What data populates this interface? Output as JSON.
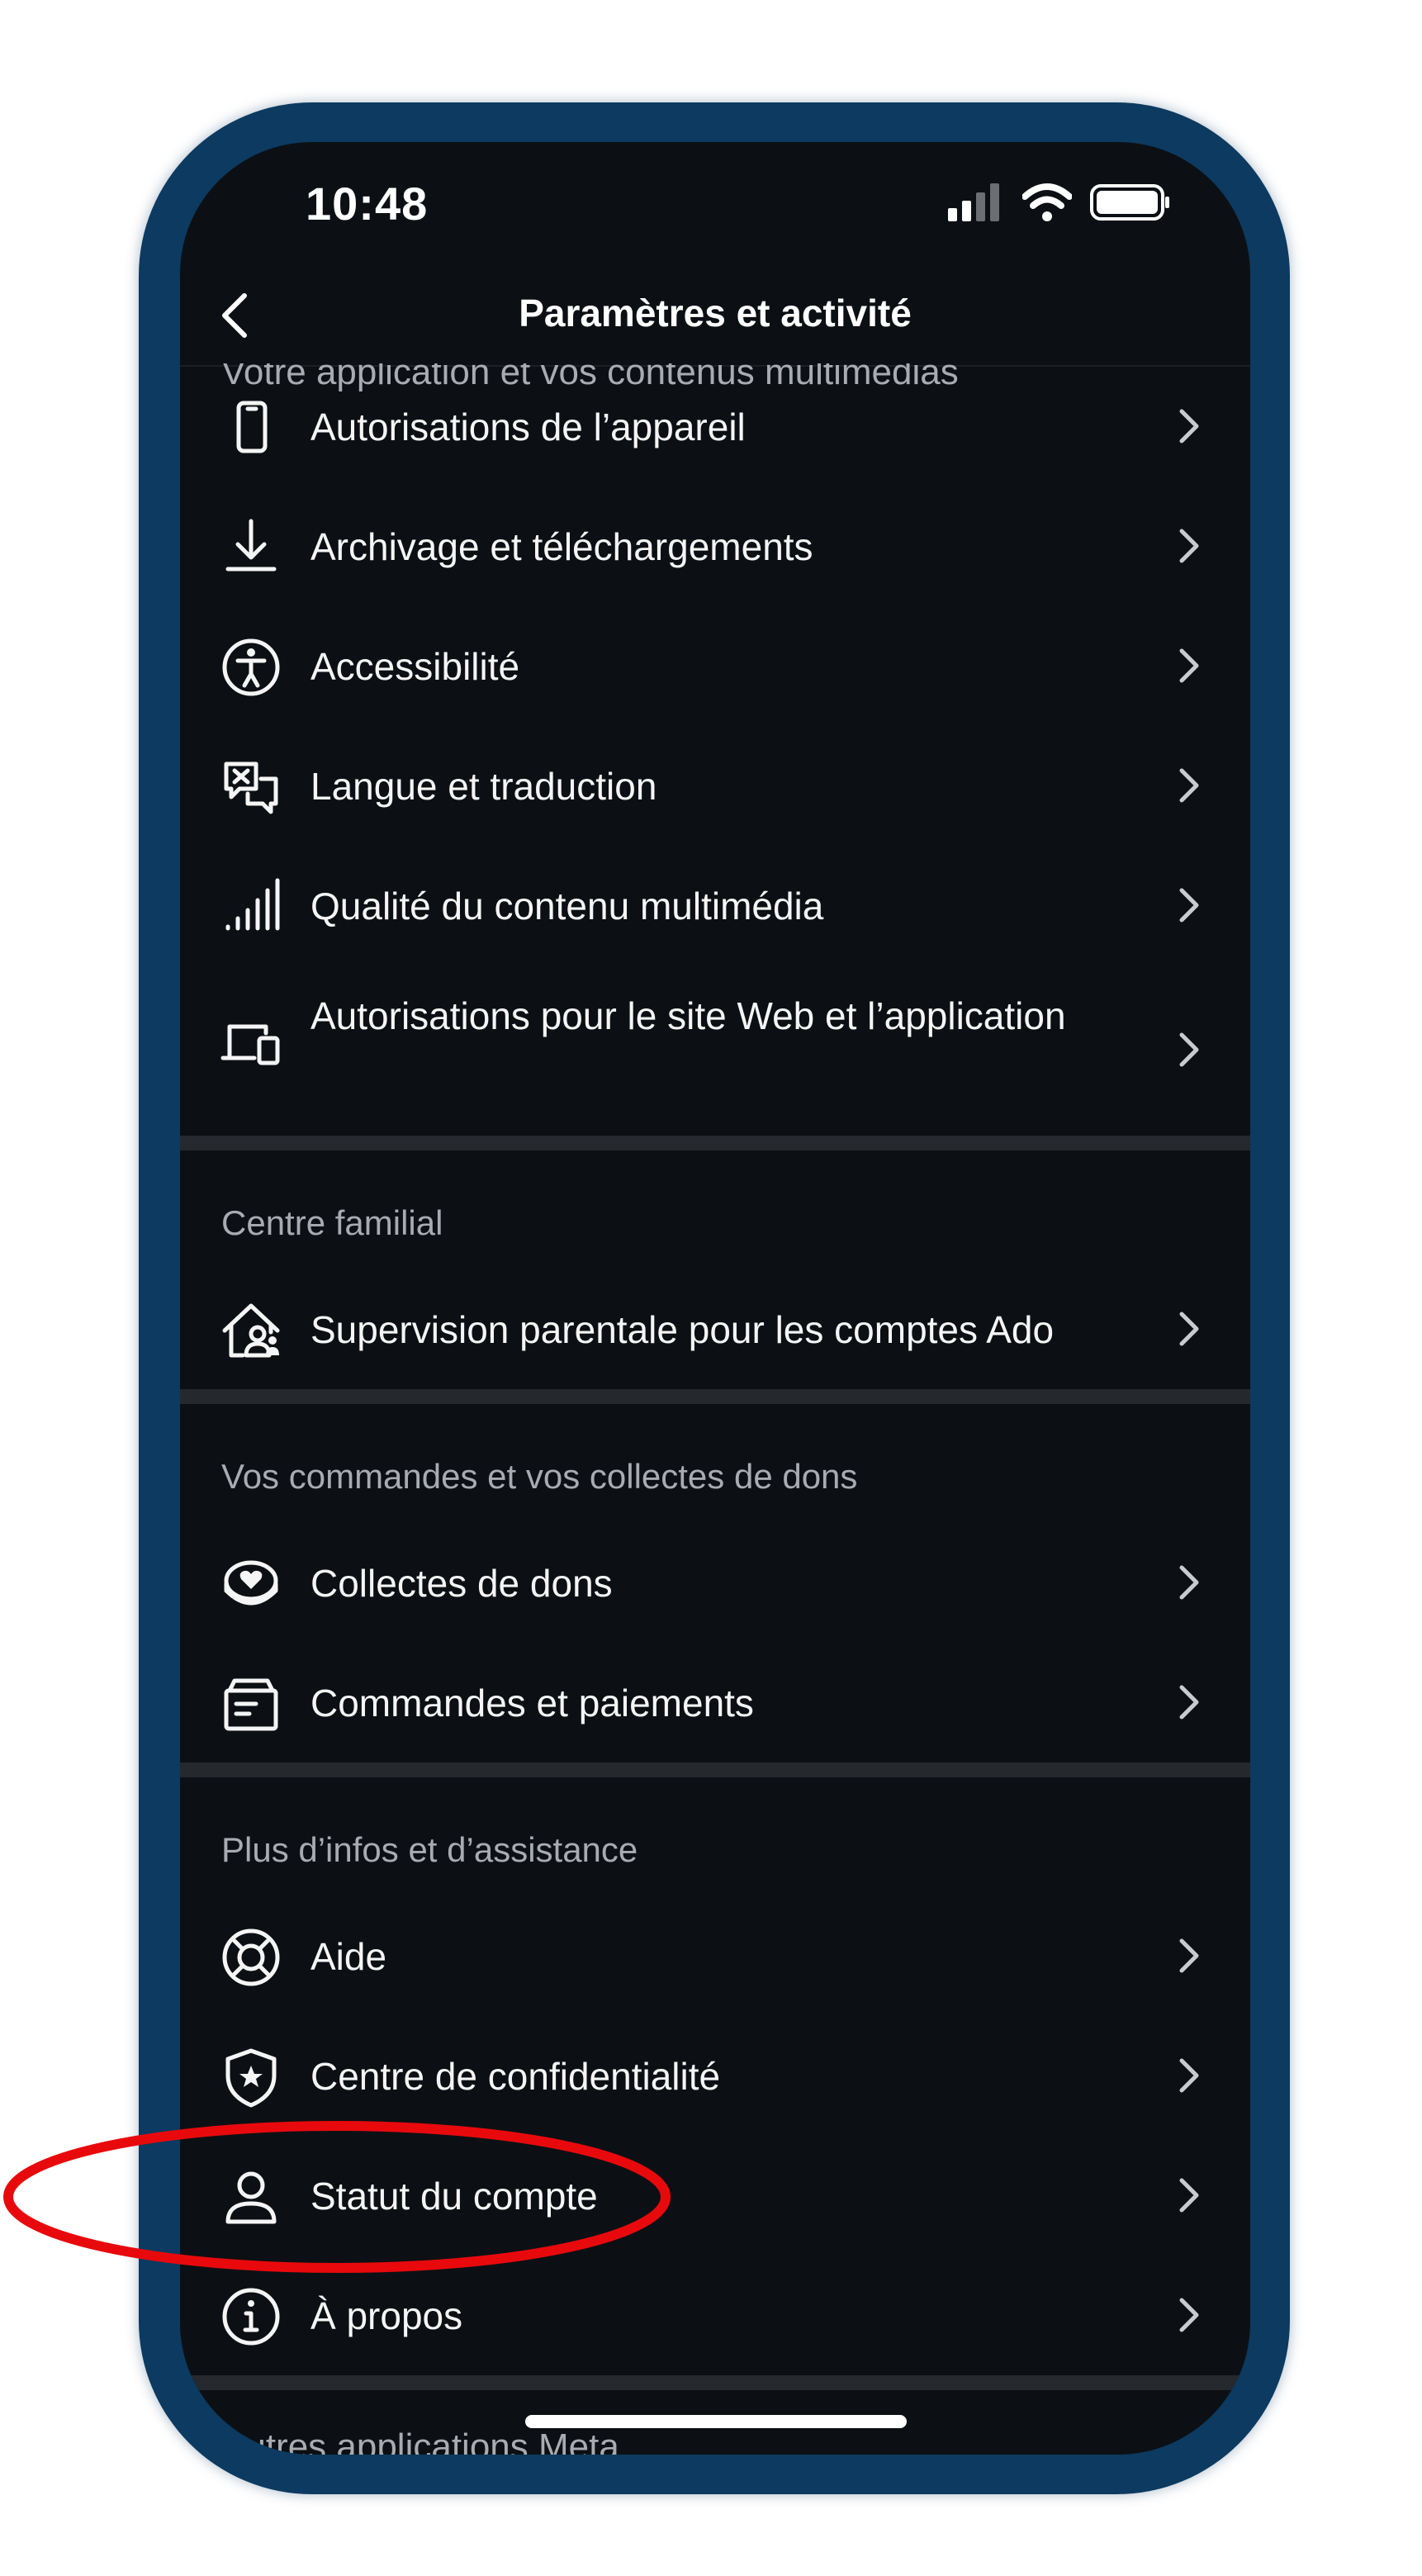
{
  "status_bar": {
    "time": "10:48"
  },
  "header": {
    "title": "Paramètres et activité",
    "cut_section_label": "Votre application et vos contenus multimédias"
  },
  "sections": {
    "app_media": {
      "items": [
        {
          "label": "Autorisations de l’appareil",
          "icon": "phone-icon"
        },
        {
          "label": "Archivage et téléchargements",
          "icon": "download-icon"
        },
        {
          "label": "Accessibilité",
          "icon": "accessibility-icon"
        },
        {
          "label": "Langue et traduction",
          "icon": "translate-icon"
        },
        {
          "label": "Qualité du contenu multimédia",
          "icon": "signal-bars-icon"
        },
        {
          "label": "Autorisations pour le site Web et l’application",
          "icon": "devices-icon"
        }
      ]
    },
    "family": {
      "title": "Centre familial",
      "items": [
        {
          "label": "Supervision parentale pour les comptes Ado",
          "icon": "house-person-icon"
        }
      ]
    },
    "orders": {
      "title": "Vos commandes et vos collectes de dons",
      "items": [
        {
          "label": "Collectes de dons",
          "icon": "donation-heart-icon"
        },
        {
          "label": "Commandes et paiements",
          "icon": "receipt-box-icon"
        }
      ]
    },
    "support": {
      "title": "Plus d’infos et d’assistance",
      "items": [
        {
          "label": "Aide",
          "icon": "lifebuoy-icon"
        },
        {
          "label": "Centre de confidentialité",
          "icon": "shield-star-icon"
        },
        {
          "label": "Statut du compte",
          "icon": "person-icon"
        },
        {
          "label": "À propos",
          "icon": "info-icon"
        }
      ]
    },
    "cut_footer_label": "Autres applications Meta"
  },
  "colors": {
    "frame": "#0c3a60",
    "screen_bg": "#0c1014",
    "highlight": "#e8090d"
  }
}
